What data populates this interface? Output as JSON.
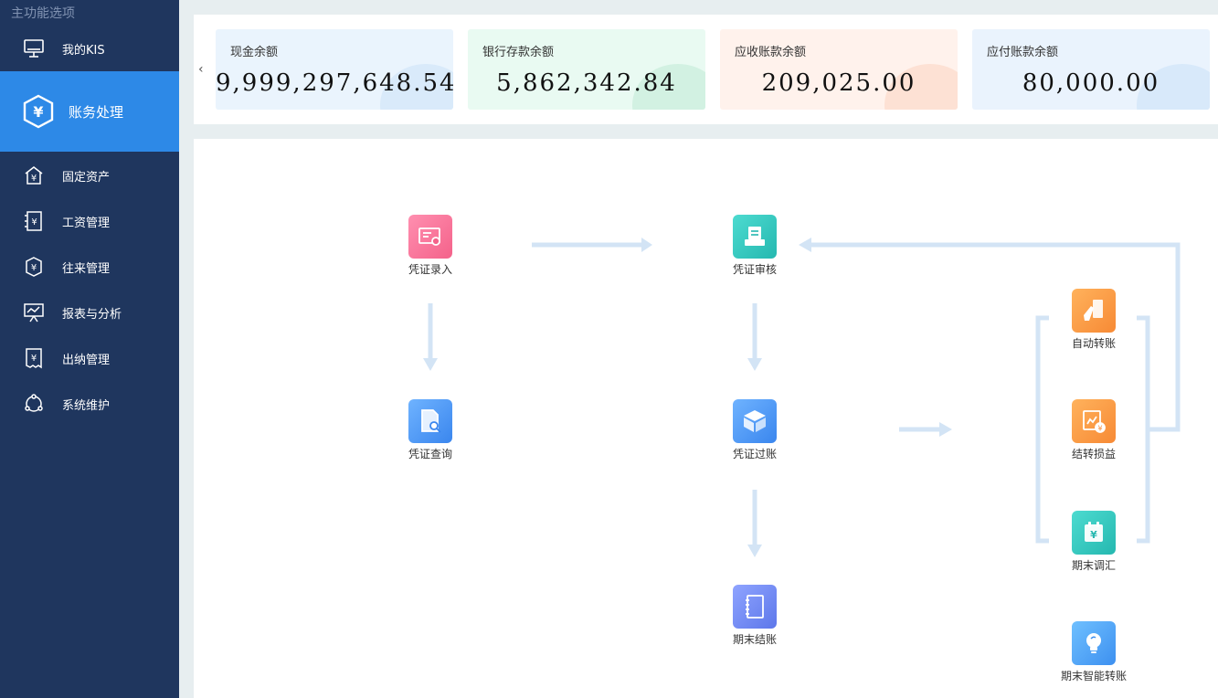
{
  "sidebar": {
    "title": "主功能选项",
    "items": [
      {
        "label": "我的KIS",
        "icon": "monitor-icon"
      },
      {
        "label": "账务处理",
        "icon": "yen-shield-icon"
      },
      {
        "label": "固定资产",
        "icon": "yen-house-icon"
      },
      {
        "label": "工资管理",
        "icon": "yen-document-icon"
      },
      {
        "label": "往来管理",
        "icon": "yen-exchange-icon"
      },
      {
        "label": "报表与分析",
        "icon": "presentation-chart-icon"
      },
      {
        "label": "出纳管理",
        "icon": "yen-receipt-icon"
      },
      {
        "label": "系统维护",
        "icon": "cycle-nodes-icon"
      }
    ],
    "active": "账务处理",
    "active_color": "#2d89e7",
    "bg_color": "#1f365e"
  },
  "balances": {
    "scroll_left_icon": "chevron-left-icon",
    "cards": [
      {
        "label": "现金余额",
        "value": "9,999,297,648.54"
      },
      {
        "label": "银行存款余额",
        "value": "5,862,342.84"
      },
      {
        "label": "应收账款余额",
        "value": "209,025.00"
      },
      {
        "label": "应付账款余额",
        "value": "80,000.00"
      }
    ]
  },
  "flow": {
    "nodes": {
      "voucher_entry": {
        "label": "凭证录入",
        "icon": "voucher-entry-icon"
      },
      "voucher_review": {
        "label": "凭证审核",
        "icon": "voucher-review-icon"
      },
      "voucher_query": {
        "label": "凭证查询",
        "icon": "voucher-query-icon"
      },
      "voucher_post": {
        "label": "凭证过账",
        "icon": "voucher-post-icon"
      },
      "period_close": {
        "label": "期末结账",
        "icon": "notebook-icon"
      },
      "auto_transfer": {
        "label": "自动转账",
        "icon": "auto-transfer-icon"
      },
      "profit_loss_transfer": {
        "label": "结转损益",
        "icon": "profit-loss-icon"
      },
      "period_exchange": {
        "label": "期末调汇",
        "icon": "exchange-adjust-icon"
      },
      "smart_transfer": {
        "label": "期末智能转账",
        "icon": "lightbulb-icon"
      }
    },
    "arrow_color": "#d3e4f5"
  }
}
